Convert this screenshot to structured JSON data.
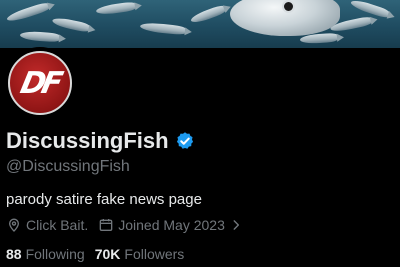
{
  "profile": {
    "display_name": "DiscussingFish",
    "handle": "@DiscussingFish",
    "avatar_text": "DF",
    "verified": true,
    "bio": "parody satire fake news page",
    "location": "Click Bait.",
    "joined": "Joined May 2023",
    "following_count": "88",
    "following_label": "Following",
    "followers_count": "70K",
    "followers_label": "Followers"
  },
  "icons": {
    "verified": "verified-badge-icon",
    "location": "location-pin-icon",
    "calendar": "calendar-icon",
    "chevron": "chevron-right-icon"
  },
  "colors": {
    "background": "#000000",
    "text_primary": "#e7e9ea",
    "text_secondary": "#71767b",
    "verified_blue": "#1d9bf0",
    "avatar_red": "#b51f1f"
  }
}
